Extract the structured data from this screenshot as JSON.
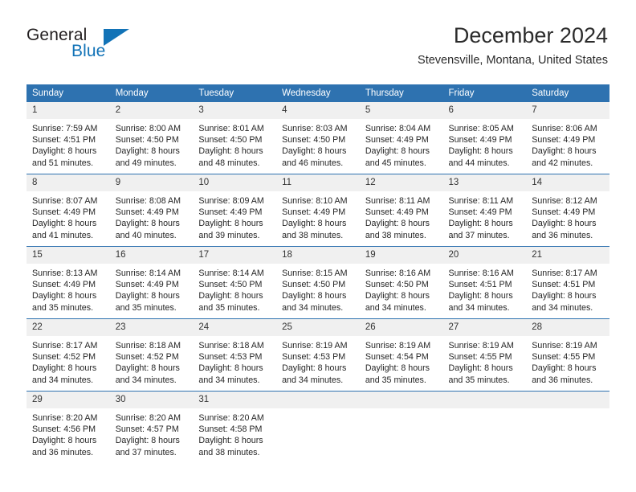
{
  "logo": {
    "word_top": "General",
    "word_bottom": "Blue",
    "triangle_icon": "blue-triangle-icon",
    "color_dark": "#231f20",
    "color_blue": "#1273b7"
  },
  "header": {
    "title": "December 2024",
    "location": "Stevensville, Montana, United States"
  },
  "theme": {
    "header_blue": "#2e72b0",
    "daynum_gray": "#f0f0f0",
    "text": "#262626"
  },
  "weekday_headers": [
    "Sunday",
    "Monday",
    "Tuesday",
    "Wednesday",
    "Thursday",
    "Friday",
    "Saturday"
  ],
  "labels": {
    "sunrise_prefix": "Sunrise:",
    "sunset_prefix": "Sunset:",
    "daylight_prefix": "Daylight:"
  },
  "weeks": [
    [
      {
        "day": "1",
        "sunrise": "Sunrise: 7:59 AM",
        "sunset": "Sunset: 4:51 PM",
        "daylight1": "Daylight: 8 hours",
        "daylight2": "and 51 minutes."
      },
      {
        "day": "2",
        "sunrise": "Sunrise: 8:00 AM",
        "sunset": "Sunset: 4:50 PM",
        "daylight1": "Daylight: 8 hours",
        "daylight2": "and 49 minutes."
      },
      {
        "day": "3",
        "sunrise": "Sunrise: 8:01 AM",
        "sunset": "Sunset: 4:50 PM",
        "daylight1": "Daylight: 8 hours",
        "daylight2": "and 48 minutes."
      },
      {
        "day": "4",
        "sunrise": "Sunrise: 8:03 AM",
        "sunset": "Sunset: 4:50 PM",
        "daylight1": "Daylight: 8 hours",
        "daylight2": "and 46 minutes."
      },
      {
        "day": "5",
        "sunrise": "Sunrise: 8:04 AM",
        "sunset": "Sunset: 4:49 PM",
        "daylight1": "Daylight: 8 hours",
        "daylight2": "and 45 minutes."
      },
      {
        "day": "6",
        "sunrise": "Sunrise: 8:05 AM",
        "sunset": "Sunset: 4:49 PM",
        "daylight1": "Daylight: 8 hours",
        "daylight2": "and 44 minutes."
      },
      {
        "day": "7",
        "sunrise": "Sunrise: 8:06 AM",
        "sunset": "Sunset: 4:49 PM",
        "daylight1": "Daylight: 8 hours",
        "daylight2": "and 42 minutes."
      }
    ],
    [
      {
        "day": "8",
        "sunrise": "Sunrise: 8:07 AM",
        "sunset": "Sunset: 4:49 PM",
        "daylight1": "Daylight: 8 hours",
        "daylight2": "and 41 minutes."
      },
      {
        "day": "9",
        "sunrise": "Sunrise: 8:08 AM",
        "sunset": "Sunset: 4:49 PM",
        "daylight1": "Daylight: 8 hours",
        "daylight2": "and 40 minutes."
      },
      {
        "day": "10",
        "sunrise": "Sunrise: 8:09 AM",
        "sunset": "Sunset: 4:49 PM",
        "daylight1": "Daylight: 8 hours",
        "daylight2": "and 39 minutes."
      },
      {
        "day": "11",
        "sunrise": "Sunrise: 8:10 AM",
        "sunset": "Sunset: 4:49 PM",
        "daylight1": "Daylight: 8 hours",
        "daylight2": "and 38 minutes."
      },
      {
        "day": "12",
        "sunrise": "Sunrise: 8:11 AM",
        "sunset": "Sunset: 4:49 PM",
        "daylight1": "Daylight: 8 hours",
        "daylight2": "and 38 minutes."
      },
      {
        "day": "13",
        "sunrise": "Sunrise: 8:11 AM",
        "sunset": "Sunset: 4:49 PM",
        "daylight1": "Daylight: 8 hours",
        "daylight2": "and 37 minutes."
      },
      {
        "day": "14",
        "sunrise": "Sunrise: 8:12 AM",
        "sunset": "Sunset: 4:49 PM",
        "daylight1": "Daylight: 8 hours",
        "daylight2": "and 36 minutes."
      }
    ],
    [
      {
        "day": "15",
        "sunrise": "Sunrise: 8:13 AM",
        "sunset": "Sunset: 4:49 PM",
        "daylight1": "Daylight: 8 hours",
        "daylight2": "and 35 minutes."
      },
      {
        "day": "16",
        "sunrise": "Sunrise: 8:14 AM",
        "sunset": "Sunset: 4:49 PM",
        "daylight1": "Daylight: 8 hours",
        "daylight2": "and 35 minutes."
      },
      {
        "day": "17",
        "sunrise": "Sunrise: 8:14 AM",
        "sunset": "Sunset: 4:50 PM",
        "daylight1": "Daylight: 8 hours",
        "daylight2": "and 35 minutes."
      },
      {
        "day": "18",
        "sunrise": "Sunrise: 8:15 AM",
        "sunset": "Sunset: 4:50 PM",
        "daylight1": "Daylight: 8 hours",
        "daylight2": "and 34 minutes."
      },
      {
        "day": "19",
        "sunrise": "Sunrise: 8:16 AM",
        "sunset": "Sunset: 4:50 PM",
        "daylight1": "Daylight: 8 hours",
        "daylight2": "and 34 minutes."
      },
      {
        "day": "20",
        "sunrise": "Sunrise: 8:16 AM",
        "sunset": "Sunset: 4:51 PM",
        "daylight1": "Daylight: 8 hours",
        "daylight2": "and 34 minutes."
      },
      {
        "day": "21",
        "sunrise": "Sunrise: 8:17 AM",
        "sunset": "Sunset: 4:51 PM",
        "daylight1": "Daylight: 8 hours",
        "daylight2": "and 34 minutes."
      }
    ],
    [
      {
        "day": "22",
        "sunrise": "Sunrise: 8:17 AM",
        "sunset": "Sunset: 4:52 PM",
        "daylight1": "Daylight: 8 hours",
        "daylight2": "and 34 minutes."
      },
      {
        "day": "23",
        "sunrise": "Sunrise: 8:18 AM",
        "sunset": "Sunset: 4:52 PM",
        "daylight1": "Daylight: 8 hours",
        "daylight2": "and 34 minutes."
      },
      {
        "day": "24",
        "sunrise": "Sunrise: 8:18 AM",
        "sunset": "Sunset: 4:53 PM",
        "daylight1": "Daylight: 8 hours",
        "daylight2": "and 34 minutes."
      },
      {
        "day": "25",
        "sunrise": "Sunrise: 8:19 AM",
        "sunset": "Sunset: 4:53 PM",
        "daylight1": "Daylight: 8 hours",
        "daylight2": "and 34 minutes."
      },
      {
        "day": "26",
        "sunrise": "Sunrise: 8:19 AM",
        "sunset": "Sunset: 4:54 PM",
        "daylight1": "Daylight: 8 hours",
        "daylight2": "and 35 minutes."
      },
      {
        "day": "27",
        "sunrise": "Sunrise: 8:19 AM",
        "sunset": "Sunset: 4:55 PM",
        "daylight1": "Daylight: 8 hours",
        "daylight2": "and 35 minutes."
      },
      {
        "day": "28",
        "sunrise": "Sunrise: 8:19 AM",
        "sunset": "Sunset: 4:55 PM",
        "daylight1": "Daylight: 8 hours",
        "daylight2": "and 36 minutes."
      }
    ],
    [
      {
        "day": "29",
        "sunrise": "Sunrise: 8:20 AM",
        "sunset": "Sunset: 4:56 PM",
        "daylight1": "Daylight: 8 hours",
        "daylight2": "and 36 minutes."
      },
      {
        "day": "30",
        "sunrise": "Sunrise: 8:20 AM",
        "sunset": "Sunset: 4:57 PM",
        "daylight1": "Daylight: 8 hours",
        "daylight2": "and 37 minutes."
      },
      {
        "day": "31",
        "sunrise": "Sunrise: 8:20 AM",
        "sunset": "Sunset: 4:58 PM",
        "daylight1": "Daylight: 8 hours",
        "daylight2": "and 38 minutes."
      },
      {
        "day": "",
        "sunrise": "",
        "sunset": "",
        "daylight1": "",
        "daylight2": ""
      },
      {
        "day": "",
        "sunrise": "",
        "sunset": "",
        "daylight1": "",
        "daylight2": ""
      },
      {
        "day": "",
        "sunrise": "",
        "sunset": "",
        "daylight1": "",
        "daylight2": ""
      },
      {
        "day": "",
        "sunrise": "",
        "sunset": "",
        "daylight1": "",
        "daylight2": ""
      }
    ]
  ]
}
